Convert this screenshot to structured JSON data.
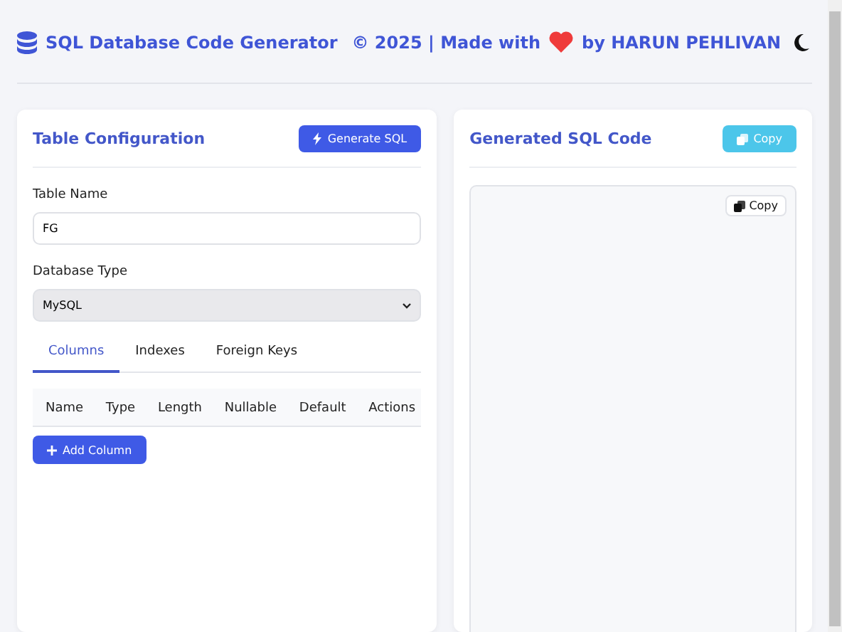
{
  "header": {
    "title": "SQL Database Code Generator",
    "credit_prefix": "© 2025 | Made with",
    "credit_suffix": "by HARUN PEHLIVAN"
  },
  "config": {
    "title": "Table Configuration",
    "generate_button": "Generate SQL",
    "table_name": {
      "label": "Table Name",
      "value": "FG"
    },
    "database_type": {
      "label": "Database Type",
      "value": "MySQL"
    },
    "tabs": [
      {
        "label": "Columns",
        "selected": true
      },
      {
        "label": "Indexes",
        "selected": false
      },
      {
        "label": "Foreign Keys",
        "selected": false
      }
    ],
    "table": {
      "columns": [
        "Name",
        "Type",
        "Length",
        "Nullable",
        "Default",
        "Actions"
      ]
    },
    "add_button": "Add Column"
  },
  "output": {
    "title": "Generated SQL Code",
    "copy_button": "Copy",
    "inner_copy_button": "Copy"
  }
}
